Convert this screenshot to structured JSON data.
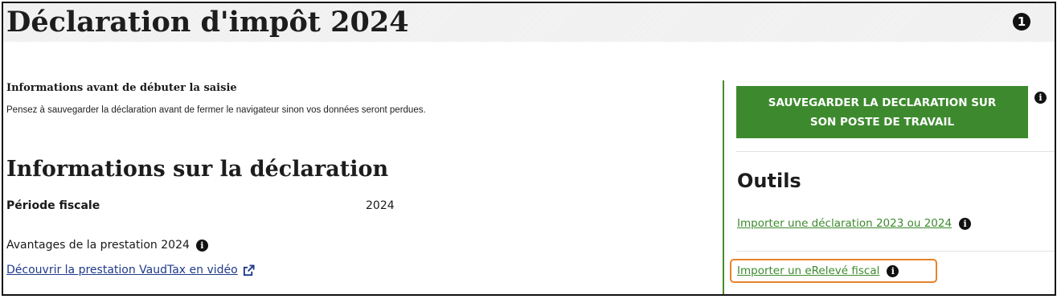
{
  "page": {
    "title": "Déclaration d'impôt 2024",
    "step_number": "1"
  },
  "intro": {
    "heading": "Informations avant de débuter la saisie",
    "text": "Pensez à sauvegarder la déclaration avant de fermer le navigateur sinon vos données seront perdues."
  },
  "declaration": {
    "title": "Informations sur la déclaration",
    "fiscal_period_label": "Période fiscale",
    "fiscal_period_value": "2024",
    "benefits_label": "Avantages de la prestation 2024",
    "video_link": "Découvrir la prestation VaudTax en vidéo"
  },
  "sidebar": {
    "save_button_label": "SAUVEGARDER LA DECLARATION SUR SON POSTE DE TRAVAIL",
    "tools_title": "Outils",
    "import_declaration_link": "Importer une déclaration 2023 ou 2024",
    "import_ereleve_link": "Importer un eRelevé fiscal"
  },
  "icons": {
    "info": "i"
  },
  "colors": {
    "primary_green": "#3d8a2e",
    "link_blue": "#1f3a8a",
    "highlight_orange": "#e8832a"
  }
}
